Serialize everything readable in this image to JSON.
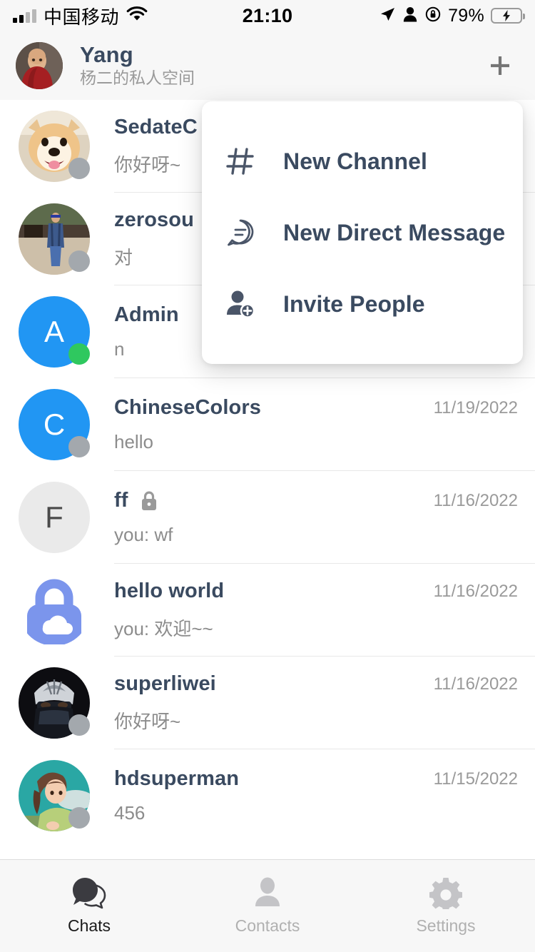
{
  "status_bar": {
    "carrier": "中国移动",
    "time": "21:10",
    "battery_percent": "79%",
    "icons": [
      "signal-bars-icon",
      "wifi-icon",
      "location-arrow-icon",
      "person-icon",
      "rotation-lock-icon",
      "battery-charging-icon"
    ]
  },
  "header": {
    "title": "Yang",
    "subtitle": "杨二的私人空间",
    "avatar": "user-avatar-photo",
    "add_button": "plus-icon"
  },
  "menu": {
    "items": [
      {
        "label": "New Channel",
        "icon": "hash-icon"
      },
      {
        "label": "New Direct Message",
        "icon": "chat-bubble-icon"
      },
      {
        "label": "Invite People",
        "icon": "person-add-icon"
      }
    ]
  },
  "chats": [
    {
      "name": "SedateC",
      "preview": "你好呀~",
      "date": "",
      "avatar_type": "photo-dog",
      "avatar_letter": "",
      "status": "offline",
      "locked": false
    },
    {
      "name": "zerosou",
      "preview": "对",
      "date": "",
      "avatar_type": "photo-person-outdoor",
      "avatar_letter": "",
      "status": "offline",
      "locked": false
    },
    {
      "name": "Admin",
      "preview": "n",
      "date": "",
      "avatar_type": "letter-blue",
      "avatar_letter": "A",
      "status": "online",
      "locked": false
    },
    {
      "name": "ChineseColors",
      "preview": "hello",
      "date": "11/19/2022",
      "avatar_type": "letter-blue",
      "avatar_letter": "C",
      "status": "offline",
      "locked": false
    },
    {
      "name": "ff",
      "preview": "you: wf",
      "date": "11/16/2022",
      "avatar_type": "letter-gray",
      "avatar_letter": "F",
      "status": "none",
      "locked": true
    },
    {
      "name": "hello world",
      "preview": "you: 欢迎~~",
      "date": "11/16/2022",
      "avatar_type": "lock-cloud",
      "avatar_letter": "",
      "status": "none",
      "locked": false
    },
    {
      "name": "superliwei",
      "preview": "你好呀~",
      "date": "11/16/2022",
      "avatar_type": "photo-ninja",
      "avatar_letter": "",
      "status": "offline",
      "locked": false
    },
    {
      "name": "hdsuperman",
      "preview": "456",
      "date": "11/15/2022",
      "avatar_type": "photo-anime",
      "avatar_letter": "",
      "status": "offline",
      "locked": false
    }
  ],
  "tabs": [
    {
      "label": "Chats",
      "icon": "chat-bubble-icon",
      "active": true
    },
    {
      "label": "Contacts",
      "icon": "person-icon",
      "active": false
    },
    {
      "label": "Settings",
      "icon": "gear-icon",
      "active": false
    }
  ],
  "colors": {
    "accent_blue": "#2196f3",
    "online_green": "#2fc85f",
    "offline_gray": "#a3a8ad",
    "title_navy": "#3a4a60",
    "battery_yellow": "#ffd426",
    "lock_avatar_blue": "#7b95ec"
  }
}
